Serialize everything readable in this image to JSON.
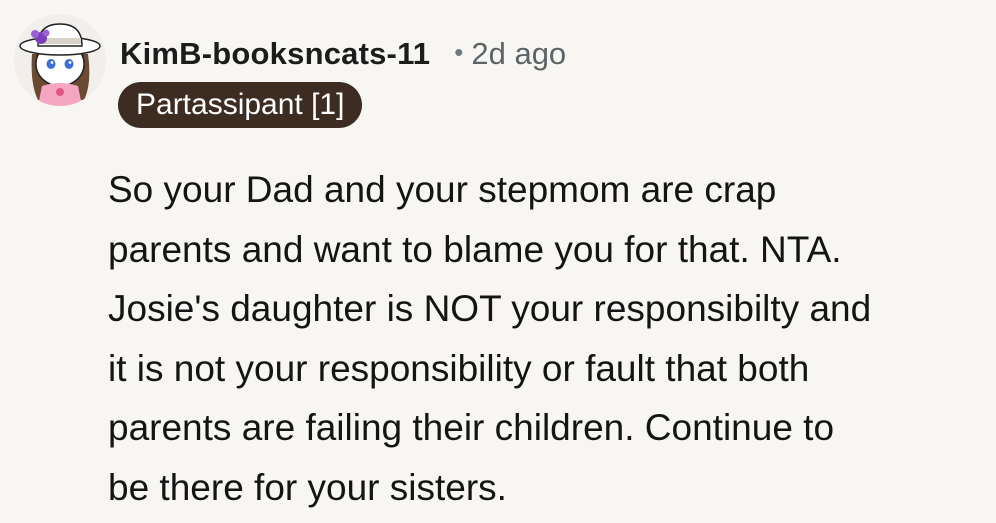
{
  "comment": {
    "username": "KimB-booksncats-11",
    "separator": "•",
    "timestamp": "2d ago",
    "flair": "Partassipant [1]",
    "avatar_icon": "snoo-avatar-with-hat-icon",
    "body_lines": [
      "So your Dad and your stepmom are crap",
      "parents and want to blame you for that. NTA.",
      "Josie's daughter is NOT your responsibilty and",
      "it is not your responsibility or fault that both",
      "parents are failing their children. Continue to",
      "be there for your sisters."
    ]
  },
  "colors": {
    "background": "#f7f6f3",
    "flair_background": "#3d2c22",
    "flair_text": "#ffffff",
    "username": "#1c1c1c",
    "timestamp": "#5c6468"
  }
}
